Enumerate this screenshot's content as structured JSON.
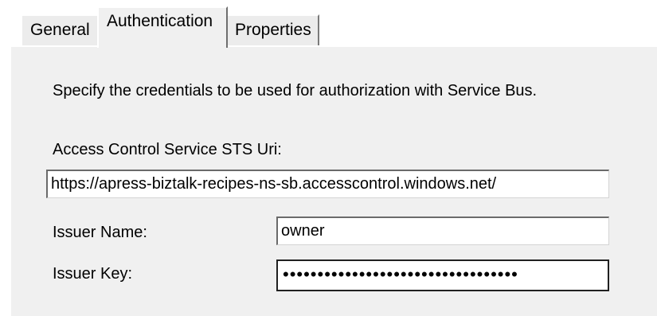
{
  "tabs": {
    "general": "General",
    "authentication": "Authentication",
    "properties": "Properties"
  },
  "authentication": {
    "description": "Specify the credentials to be used for authorization with Service Bus.",
    "acs_label": "Access Control Service STS Uri:",
    "acs_value": "https://apress-biztalk-recipes-ns-sb.accesscontrol.windows.net/",
    "issuer_name_label": "Issuer Name:",
    "issuer_name_value": "owner",
    "issuer_key_label": "Issuer Key:",
    "issuer_key_value": "••••••••••••••••••••••••••••••••••"
  }
}
